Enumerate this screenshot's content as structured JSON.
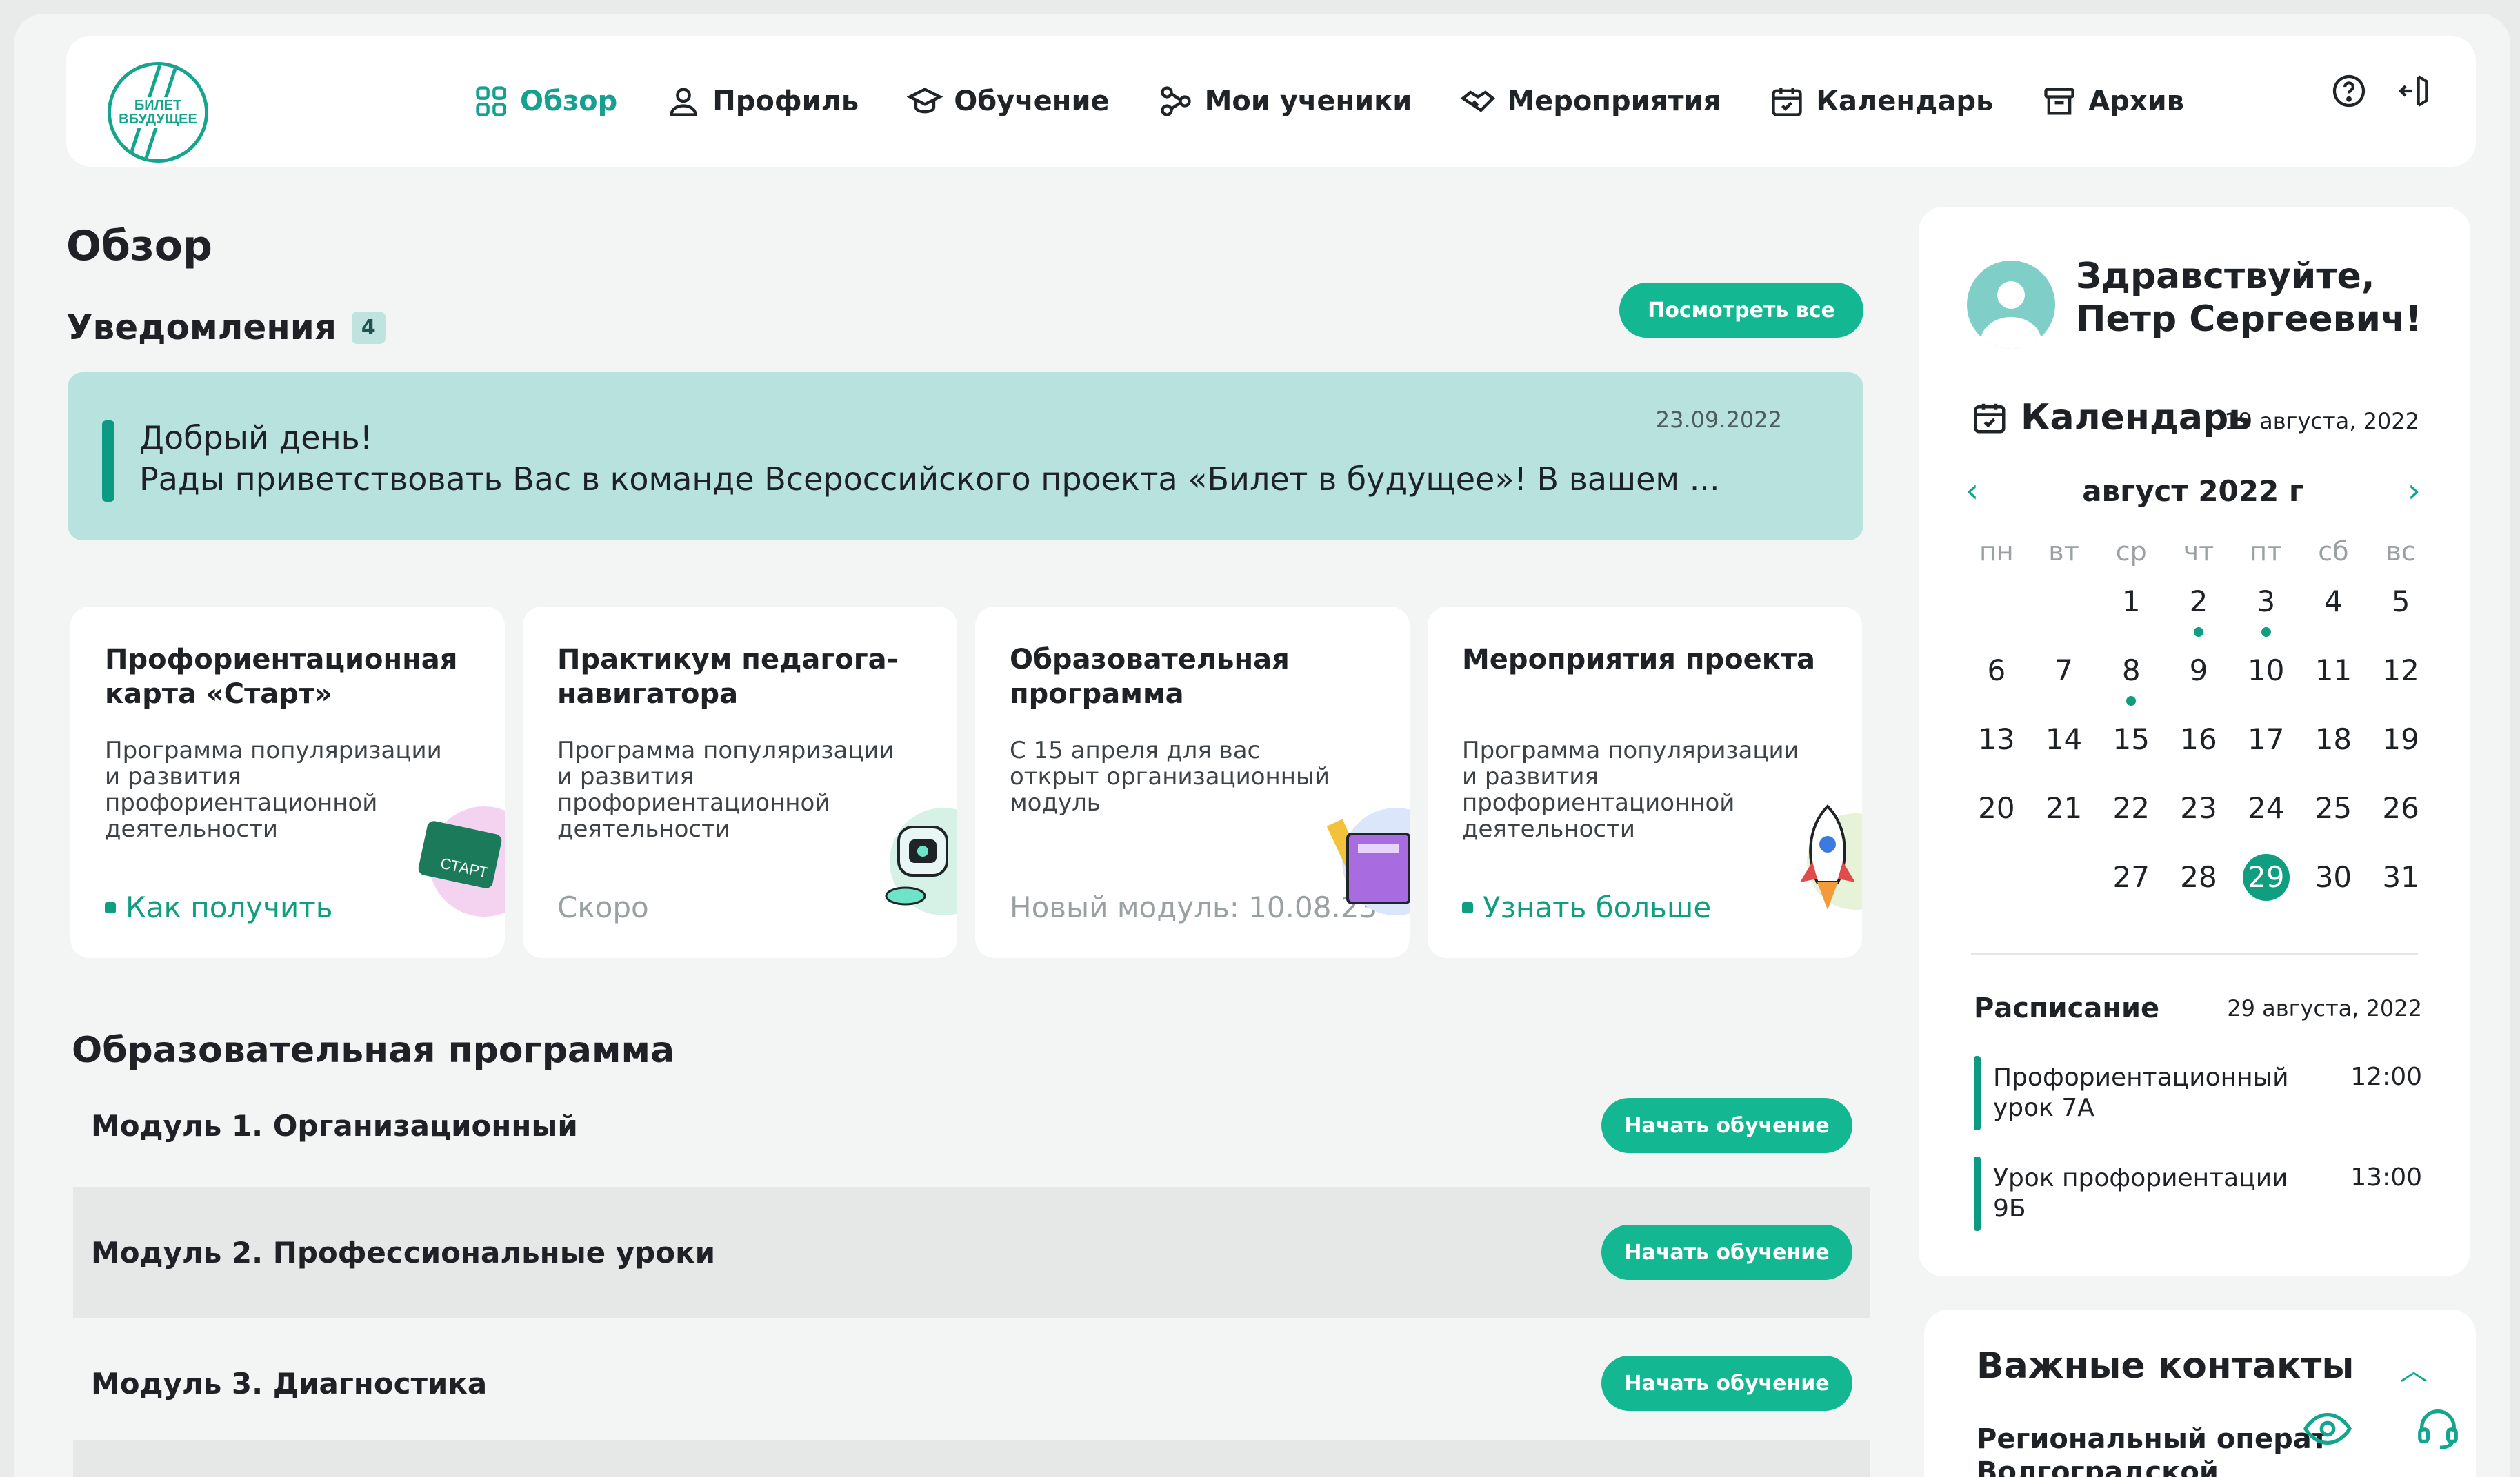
{
  "header": {
    "logo_text": "БИЛЕТ ВБУДУЩЕЕ",
    "nav": [
      {
        "label": "Обзор",
        "icon": "grid-icon",
        "active": true
      },
      {
        "label": "Профиль",
        "icon": "user-icon"
      },
      {
        "label": "Обучение",
        "icon": "graduation-cap-icon"
      },
      {
        "label": "Мои ученики",
        "icon": "network-icon"
      },
      {
        "label": "Мероприятия",
        "icon": "handshake-icon"
      },
      {
        "label": "Календарь",
        "icon": "calendar-icon"
      },
      {
        "label": "Архив",
        "icon": "archive-icon"
      }
    ],
    "icons": [
      "help-icon",
      "logout-icon"
    ]
  },
  "page": {
    "title": "Обзор",
    "notifications_title": "Уведомления",
    "notifications_count": "4",
    "view_all": "Посмотреть все"
  },
  "notification": {
    "line1": "Добрый день!",
    "line2": "Рады приветствовать Вас в команде Всероссийского проекта «Билет в будущее»! В вашем ...",
    "date": "23.09.2022"
  },
  "cards": [
    {
      "title": "Профориентационная карта «Старт»",
      "desc": "Программа популяризации и развития профориентационной деятельности",
      "link": "Как получить",
      "muted": "",
      "illustration": "ticket-card-illustration"
    },
    {
      "title": "Практикум педагога-навигатора",
      "desc": "Программа популяризации и развития профориентационной деятельности",
      "link": "",
      "muted": "Скоро",
      "illustration": "robot-illustration"
    },
    {
      "title": "Образовательная программа",
      "desc": "С 15 апреля для вас открыт организационный модуль",
      "link": "",
      "muted": "Новый модуль: 10.08.23",
      "illustration": "books-illustration"
    },
    {
      "title": "Мероприятия проекта",
      "desc": "Программа популяризации и развития профориентационной деятельности",
      "link": "Узнать больше",
      "muted": "",
      "illustration": "rocket-illustration"
    }
  ],
  "program": {
    "title": "Образовательная программа",
    "modules": [
      {
        "title": "Модуль 1. Организационный",
        "button": "Начать обучение"
      },
      {
        "title": "Модуль 2. Профессиональные уроки",
        "button": "Начать обучение"
      },
      {
        "title": "Модуль 3. Диагностика",
        "button": "Начать обучение"
      }
    ]
  },
  "sidebar": {
    "greeting_line1": "Здравствуйте,",
    "greeting_line2": "Петр Сергеевич!",
    "calendar_title": "Календарь",
    "calendar_date": "19 августа, 2022",
    "month": "август 2022 г",
    "weekdays": [
      "пн",
      "вт",
      "ср",
      "чт",
      "пт",
      "сб",
      "вс"
    ],
    "days": [
      "",
      "",
      "1",
      "2",
      "3",
      "4",
      "5",
      "6",
      "7",
      "8",
      "9",
      "10",
      "11",
      "12",
      "13",
      "14",
      "15",
      "16",
      "17",
      "18",
      "19",
      "20",
      "21",
      "22",
      "23",
      "24",
      "25",
      "26",
      "",
      "",
      "27",
      "28",
      "29",
      "30",
      "31"
    ],
    "event_days": [
      "2",
      "3",
      "8"
    ],
    "today": "29",
    "schedule_title": "Расписание",
    "schedule_date": "29 августа, 2022",
    "schedule": [
      {
        "name": "Профориентационный урок 7А",
        "time": "12:00"
      },
      {
        "name": "Урок профориентации 9Б",
        "time": "13:00"
      }
    ]
  },
  "contacts": {
    "title": "Важные контакты",
    "operator": "Региональный операт Волгоградской област"
  },
  "colors": {
    "accent": "#13b791",
    "accent_dark": "#0f9e7f",
    "notification_bg": "#b7e2de"
  }
}
